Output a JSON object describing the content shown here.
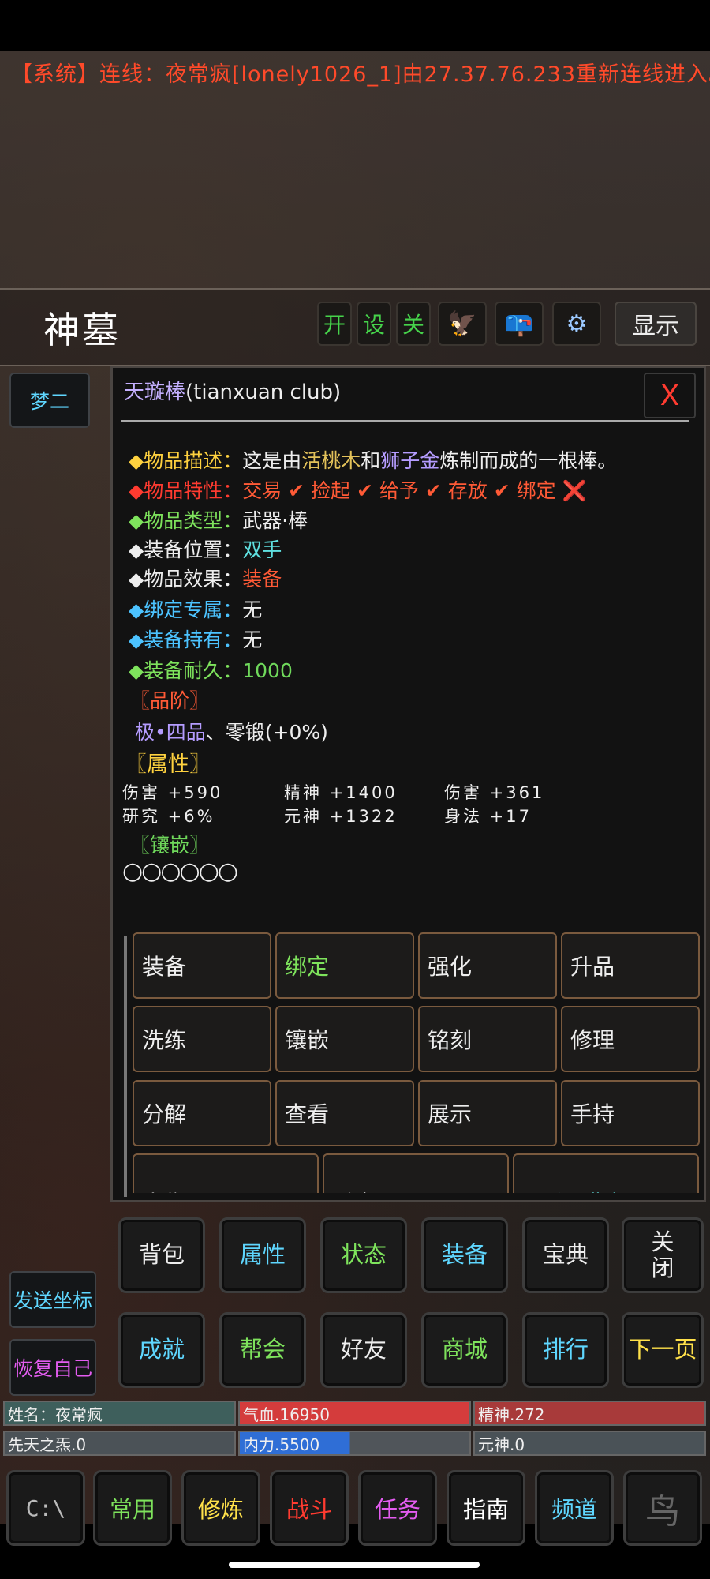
{
  "system_message": "【系统】连线：夜常疯[lonely1026_1]由27.37.76.233重新连线进入。",
  "location": "神墓",
  "toolbar": {
    "open": "开",
    "settings": "设",
    "close": "关",
    "eagle_icon": "🦅",
    "mailbox_icon": "📪",
    "gear_icon": "⚙",
    "show": "显示"
  },
  "left_buttons": {
    "dream": "梦二",
    "send_coords": "发送坐标",
    "restore_self": "恢复自己"
  },
  "item_panel": {
    "name": "天璇棒",
    "name_en": "(tianxuan club)",
    "close": "X",
    "desc": {
      "label": "◆物品描述：",
      "prefix": "这是由",
      "mat1": "活桃木",
      "and": "和",
      "mat2": "狮子金",
      "suffix": "炼制而成的一根棒。"
    },
    "traits": {
      "label": "◆物品特性：",
      "value": "交易 ✔ 捡起 ✔ 给予 ✔ 存放 ✔ 绑定 ❌"
    },
    "type": {
      "label": "◆物品类型：",
      "value": "武器·棒"
    },
    "slot": {
      "label": "◆装备位置：",
      "value": "双手"
    },
    "effect": {
      "label": "◆物品效果：",
      "value": "装备"
    },
    "binding": {
      "label": "◆绑定专属：",
      "value": "无"
    },
    "holder": {
      "label": "◆装备持有：",
      "value": "无"
    },
    "durability": {
      "label": "◆装备耐久：",
      "value": "1000"
    },
    "grade_header": "〖品阶〗",
    "grade": "极•四品",
    "grade_rest": "、零锻(+0%)",
    "attr_header": "〖属性〗",
    "attributes": [
      "伤害 +590",
      "精神 +1400",
      "伤害 +361",
      "研究 +6%",
      "元神 +1322",
      "身法 +17"
    ],
    "inlay_header": "〖镶嵌〗",
    "inlay_slots": "○○○○○○",
    "actions": [
      "装备",
      "绑定",
      "强化",
      "升品",
      "洗练",
      "镶嵌",
      "铭刻",
      "修理",
      "分解",
      "查看",
      "展示",
      "手持"
    ],
    "actions_last_row": [
      "出售",
      "丢弃",
      "<返回背包>"
    ]
  },
  "menu_row1": [
    "背包",
    "属性",
    "状态",
    "装备",
    "宝典",
    "关闭"
  ],
  "menu_row2": [
    "成就",
    "帮会",
    "好友",
    "商城",
    "排行",
    "下一页"
  ],
  "stats": {
    "name": "姓名：夜常疯",
    "hp": "气血.16950",
    "spirit": "精神.272",
    "innate": "先天之炁.0",
    "mana": "内力.5500",
    "soul": "元神.0"
  },
  "bottom_bar": [
    "常用",
    "修炼",
    "战斗",
    "任务",
    "指南",
    "频道"
  ],
  "bottom_icons": {
    "console": "C:\\",
    "bird": "鸟"
  }
}
